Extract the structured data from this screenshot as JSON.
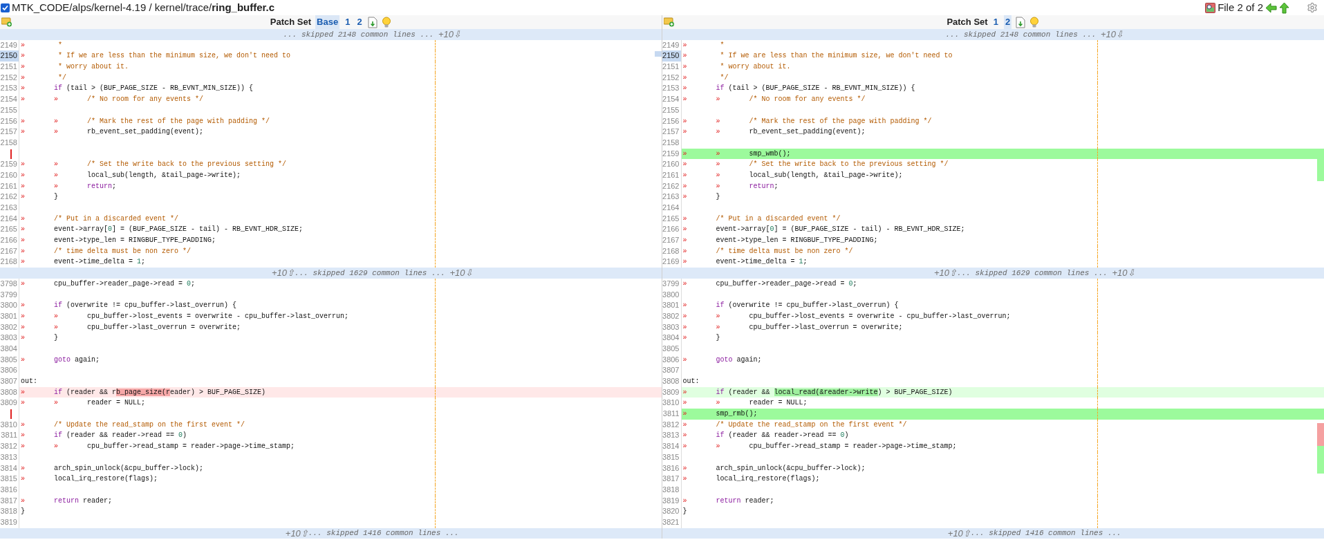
{
  "top_bar": {
    "reviewed": true,
    "path": "MTK_CODE/alps/kernel-4.19 / kernel/trace/",
    "file_name": "ring_buffer.c",
    "file_counter": "File 2 of 2"
  },
  "panes": [
    {
      "kind": "old",
      "patch_set": {
        "label": "Patch Set",
        "options": [
          {
            "label": "Base",
            "selected": true
          },
          {
            "label": "1",
            "selected": false
          },
          {
            "label": "2",
            "selected": false
          }
        ]
      },
      "sections": [
        {
          "kind": "skip",
          "text": "... skipped 2148 common lines ... ",
          "down": "+10⇩"
        },
        {
          "kind": "rows",
          "rows": [
            {
              "kind": "common",
              "number": "2149",
              "selected": false,
              "segments": [
                {
                  "kind": "tab",
                  "text": "»"
                },
                {
                  "kind": "comment",
                  "text": " *"
                }
              ]
            },
            {
              "kind": "common",
              "number": "2150",
              "selected": true,
              "segments": [
                {
                  "kind": "tab",
                  "text": "»"
                },
                {
                  "kind": "comment",
                  "text": " * If we are less than the minimum size, we don't need to"
                }
              ]
            },
            {
              "kind": "common",
              "number": "2151",
              "selected": false,
              "segments": [
                {
                  "kind": "tab",
                  "text": "»"
                },
                {
                  "kind": "comment",
                  "text": " * worry about it."
                }
              ]
            },
            {
              "kind": "common",
              "number": "2152",
              "selected": false,
              "segments": [
                {
                  "kind": "tab",
                  "text": "»"
                },
                {
                  "kind": "comment",
                  "text": " */"
                }
              ]
            },
            {
              "kind": "common",
              "number": "2153",
              "selected": false,
              "segments": [
                {
                  "kind": "tab",
                  "text": "»"
                },
                {
                  "kind": "keyword",
                  "text": "if"
                },
                {
                  "kind": "plain",
                  "text": " (tail > (BUF_PAGE_SIZE - RB_EVNT_MIN_SIZE)) {"
                }
              ]
            },
            {
              "kind": "common",
              "number": "2154",
              "selected": false,
              "segments": [
                {
                  "kind": "tab",
                  "text": "»"
                },
                {
                  "kind": "tab",
                  "text": "»"
                },
                {
                  "kind": "comment",
                  "text": "/* No room for any events */"
                }
              ]
            },
            {
              "kind": "common",
              "number": "2155",
              "selected": false
            },
            {
              "kind": "common",
              "number": "2156",
              "selected": false,
              "segments": [
                {
                  "kind": "tab",
                  "text": "»"
                },
                {
                  "kind": "tab",
                  "text": "»"
                },
                {
                  "kind": "comment",
                  "text": "/* Mark the rest of the page with padding */"
                }
              ]
            },
            {
              "kind": "common",
              "number": "2157",
              "selected": false,
              "segments": [
                {
                  "kind": "tab",
                  "text": "»"
                },
                {
                  "kind": "tab",
                  "text": "»"
                },
                {
                  "kind": "plain",
                  "text": "rb_event_set_padding(event);"
                }
              ]
            },
            {
              "kind": "common",
              "number": "2158",
              "selected": false
            },
            {
              "kind": "gap"
            },
            {
              "kind": "common",
              "number": "2159",
              "selected": false,
              "segments": [
                {
                  "kind": "tab",
                  "text": "»"
                },
                {
                  "kind": "tab",
                  "text": "»"
                },
                {
                  "kind": "comment",
                  "text": "/* Set the write back to the previous setting */"
                }
              ]
            },
            {
              "kind": "common",
              "number": "2160",
              "selected": false,
              "segments": [
                {
                  "kind": "tab",
                  "text": "»"
                },
                {
                  "kind": "tab",
                  "text": "»"
                },
                {
                  "kind": "plain",
                  "text": "local_sub(length, &tail_page->write);"
                }
              ]
            },
            {
              "kind": "common",
              "number": "2161",
              "selected": false,
              "segments": [
                {
                  "kind": "tab",
                  "text": "»"
                },
                {
                  "kind": "tab",
                  "text": "»"
                },
                {
                  "kind": "keyword",
                  "text": "return"
                },
                {
                  "kind": "plain",
                  "text": ";"
                }
              ]
            },
            {
              "kind": "common",
              "number": "2162",
              "selected": false,
              "segments": [
                {
                  "kind": "tab",
                  "text": "»"
                },
                {
                  "kind": "plain",
                  "text": "}"
                }
              ]
            },
            {
              "kind": "common",
              "number": "2163",
              "selected": false
            },
            {
              "kind": "common",
              "number": "2164",
              "selected": false,
              "segments": [
                {
                  "kind": "tab",
                  "text": "»"
                },
                {
                  "kind": "comment",
                  "text": "/* Put in a discarded event */"
                }
              ]
            },
            {
              "kind": "common",
              "number": "2165",
              "selected": false,
              "segments": [
                {
                  "kind": "tab",
                  "text": "»"
                },
                {
                  "kind": "plain",
                  "text": "event->array["
                },
                {
                  "kind": "number",
                  "text": "0"
                },
                {
                  "kind": "plain",
                  "text": "] = (BUF_PAGE_SIZE - tail) - RB_EVNT_HDR_SIZE;"
                }
              ]
            },
            {
              "kind": "common",
              "number": "2166",
              "selected": false,
              "segments": [
                {
                  "kind": "tab",
                  "text": "»"
                },
                {
                  "kind": "plain",
                  "text": "event->type_len = RINGBUF_TYPE_PADDING;"
                }
              ]
            },
            {
              "kind": "common",
              "number": "2167",
              "selected": false,
              "segments": [
                {
                  "kind": "tab",
                  "text": "»"
                },
                {
                  "kind": "comment",
                  "text": "/* time delta must be non zero */"
                }
              ]
            },
            {
              "kind": "common",
              "number": "2168",
              "selected": false,
              "segments": [
                {
                  "kind": "tab",
                  "text": "»"
                },
                {
                  "kind": "plain",
                  "text": "event->time_delta = "
                },
                {
                  "kind": "number",
                  "text": "1"
                },
                {
                  "kind": "plain",
                  "text": ";"
                }
              ]
            }
          ]
        },
        {
          "kind": "skip",
          "up": "+10⇧",
          "text": "... skipped 1629 common lines ... ",
          "down": "+10⇩"
        },
        {
          "kind": "rows",
          "rows": [
            {
              "kind": "common",
              "number": "3798",
              "selected": false,
              "segments": [
                {
                  "kind": "tab",
                  "text": "»"
                },
                {
                  "kind": "plain",
                  "text": "cpu_buffer->reader_page->read = "
                },
                {
                  "kind": "number",
                  "text": "0"
                },
                {
                  "kind": "plain",
                  "text": ";"
                }
              ]
            },
            {
              "kind": "common",
              "number": "3799",
              "selected": false
            },
            {
              "kind": "common",
              "number": "3800",
              "selected": false,
              "segments": [
                {
                  "kind": "tab",
                  "text": "»"
                },
                {
                  "kind": "keyword",
                  "text": "if"
                },
                {
                  "kind": "plain",
                  "text": " (overwrite != cpu_buffer->last_overrun) {"
                }
              ]
            },
            {
              "kind": "common",
              "number": "3801",
              "selected": false,
              "segments": [
                {
                  "kind": "tab",
                  "text": "»"
                },
                {
                  "kind": "tab",
                  "text": "»"
                },
                {
                  "kind": "plain",
                  "text": "cpu_buffer->lost_events = overwrite - cpu_buffer->last_overrun;"
                }
              ]
            },
            {
              "kind": "common",
              "number": "3802",
              "selected": false,
              "segments": [
                {
                  "kind": "tab",
                  "text": "»"
                },
                {
                  "kind": "tab",
                  "text": "»"
                },
                {
                  "kind": "plain",
                  "text": "cpu_buffer->last_overrun = overwrite;"
                }
              ]
            },
            {
              "kind": "common",
              "number": "3803",
              "selected": false,
              "segments": [
                {
                  "kind": "tab",
                  "text": "»"
                },
                {
                  "kind": "plain",
                  "text": "}"
                }
              ]
            },
            {
              "kind": "common",
              "number": "3804",
              "selected": false
            },
            {
              "kind": "common",
              "number": "3805",
              "selected": false,
              "segments": [
                {
                  "kind": "tab",
                  "text": "»"
                },
                {
                  "kind": "keyword",
                  "text": "goto"
                },
                {
                  "kind": "plain",
                  "text": " again;"
                }
              ]
            },
            {
              "kind": "common",
              "number": "3806",
              "selected": false
            },
            {
              "kind": "common",
              "number": "3807",
              "selected": false,
              "segments": [
                {
                  "kind": "plain",
                  "text": "out:"
                }
              ]
            },
            {
              "kind": "edited",
              "number": "3808",
              "selected": false,
              "segments": [
                {
                  "kind": "tab",
                  "text": "»"
                },
                {
                  "kind": "keyword",
                  "text": "if"
                },
                {
                  "kind": "plain",
                  "text": " (reader && r"
                },
                {
                  "kind": "changed",
                  "text": "b_page_size(r"
                },
                {
                  "kind": "plain",
                  "text": "eader) > BUF_PAGE_SIZE)"
                }
              ]
            },
            {
              "kind": "common",
              "number": "3809",
              "selected": false,
              "segments": [
                {
                  "kind": "tab",
                  "text": "»"
                },
                {
                  "kind": "tab",
                  "text": "»"
                },
                {
                  "kind": "plain",
                  "text": "reader = NULL;"
                }
              ]
            },
            {
              "kind": "gap"
            },
            {
              "kind": "common",
              "number": "3810",
              "selected": false,
              "segments": [
                {
                  "kind": "tab",
                  "text": "»"
                },
                {
                  "kind": "comment",
                  "text": "/* Update the read_stamp on the first event */"
                }
              ]
            },
            {
              "kind": "common",
              "number": "3811",
              "selected": false,
              "segments": [
                {
                  "kind": "tab",
                  "text": "»"
                },
                {
                  "kind": "keyword",
                  "text": "if"
                },
                {
                  "kind": "plain",
                  "text": " (reader && reader->read == "
                },
                {
                  "kind": "number",
                  "text": "0"
                },
                {
                  "kind": "plain",
                  "text": ")"
                }
              ]
            },
            {
              "kind": "common",
              "number": "3812",
              "selected": false,
              "segments": [
                {
                  "kind": "tab",
                  "text": "»"
                },
                {
                  "kind": "tab",
                  "text": "»"
                },
                {
                  "kind": "plain",
                  "text": "cpu_buffer->read_stamp = reader->page->time_stamp;"
                }
              ]
            },
            {
              "kind": "common",
              "number": "3813",
              "selected": false
            },
            {
              "kind": "common",
              "number": "3814",
              "selected": false,
              "segments": [
                {
                  "kind": "tab",
                  "text": "»"
                },
                {
                  "kind": "plain",
                  "text": "arch_spin_unlock(&cpu_buffer->lock);"
                }
              ]
            },
            {
              "kind": "common",
              "number": "3815",
              "selected": false,
              "segments": [
                {
                  "kind": "tab",
                  "text": "»"
                },
                {
                  "kind": "plain",
                  "text": "local_irq_restore(flags);"
                }
              ]
            },
            {
              "kind": "common",
              "number": "3816",
              "selected": false
            },
            {
              "kind": "common",
              "number": "3817",
              "selected": false,
              "segments": [
                {
                  "kind": "tab",
                  "text": "»"
                },
                {
                  "kind": "keyword",
                  "text": "return"
                },
                {
                  "kind": "plain",
                  "text": " reader;"
                }
              ]
            },
            {
              "kind": "common",
              "number": "3818",
              "selected": false,
              "segments": [
                {
                  "kind": "plain",
                  "text": "}"
                }
              ]
            },
            {
              "kind": "common",
              "number": "3819",
              "selected": false
            }
          ]
        },
        {
          "kind": "skip",
          "up": "+10⇧",
          "text": "... skipped 1416 common lines ..."
        }
      ]
    },
    {
      "kind": "new",
      "patch_set": {
        "label": "Patch Set",
        "options": [
          {
            "label": "1",
            "selected": false
          },
          {
            "label": "2",
            "selected": true
          }
        ]
      },
      "sections": [
        {
          "kind": "skip",
          "text": "... skipped 2148 common lines ... ",
          "down": "+10⇩"
        },
        {
          "kind": "rows",
          "rows": [
            {
              "kind": "common",
              "number": "2149",
              "selected": false,
              "segments": [
                {
                  "kind": "tab",
                  "text": "»"
                },
                {
                  "kind": "comment",
                  "text": " *"
                }
              ]
            },
            {
              "kind": "common",
              "number": "2150",
              "selected": true,
              "segments": [
                {
                  "kind": "tab",
                  "text": "»"
                },
                {
                  "kind": "comment",
                  "text": " * If we are less than the minimum size, we don't need to"
                }
              ]
            },
            {
              "kind": "common",
              "number": "2151",
              "selected": false,
              "segments": [
                {
                  "kind": "tab",
                  "text": "»"
                },
                {
                  "kind": "comment",
                  "text": " * worry about it."
                }
              ]
            },
            {
              "kind": "common",
              "number": "2152",
              "selected": false,
              "segments": [
                {
                  "kind": "tab",
                  "text": "»"
                },
                {
                  "kind": "comment",
                  "text": " */"
                }
              ]
            },
            {
              "kind": "common",
              "number": "2153",
              "selected": false,
              "segments": [
                {
                  "kind": "tab",
                  "text": "»"
                },
                {
                  "kind": "keyword",
                  "text": "if"
                },
                {
                  "kind": "plain",
                  "text": " (tail > (BUF_PAGE_SIZE - RB_EVNT_MIN_SIZE)) {"
                }
              ]
            },
            {
              "kind": "common",
              "number": "2154",
              "selected": false,
              "segments": [
                {
                  "kind": "tab",
                  "text": "»"
                },
                {
                  "kind": "tab",
                  "text": "»"
                },
                {
                  "kind": "comment",
                  "text": "/* No room for any events */"
                }
              ]
            },
            {
              "kind": "common",
              "number": "2155",
              "selected": false
            },
            {
              "kind": "common",
              "number": "2156",
              "selected": false,
              "segments": [
                {
                  "kind": "tab",
                  "text": "»"
                },
                {
                  "kind": "tab",
                  "text": "»"
                },
                {
                  "kind": "comment",
                  "text": "/* Mark the rest of the page with padding */"
                }
              ]
            },
            {
              "kind": "common",
              "number": "2157",
              "selected": false,
              "segments": [
                {
                  "kind": "tab",
                  "text": "»"
                },
                {
                  "kind": "tab",
                  "text": "»"
                },
                {
                  "kind": "plain",
                  "text": "rb_event_set_padding(event);"
                }
              ]
            },
            {
              "kind": "common",
              "number": "2158",
              "selected": false
            },
            {
              "kind": "inserted",
              "number": "2159",
              "selected": false,
              "segments": [
                {
                  "kind": "tab",
                  "text": "»"
                },
                {
                  "kind": "tab",
                  "text": "»"
                },
                {
                  "kind": "plain",
                  "text": "smp_wmb();"
                }
              ]
            },
            {
              "kind": "common",
              "number": "2160",
              "selected": false,
              "segments": [
                {
                  "kind": "tab",
                  "text": "»"
                },
                {
                  "kind": "tab",
                  "text": "»"
                },
                {
                  "kind": "comment",
                  "text": "/* Set the write back to the previous setting */"
                }
              ]
            },
            {
              "kind": "common",
              "number": "2161",
              "selected": false,
              "segments": [
                {
                  "kind": "tab",
                  "text": "»"
                },
                {
                  "kind": "tab",
                  "text": "»"
                },
                {
                  "kind": "plain",
                  "text": "local_sub(length, &tail_page->write);"
                }
              ]
            },
            {
              "kind": "common",
              "number": "2162",
              "selected": false,
              "segments": [
                {
                  "kind": "tab",
                  "text": "»"
                },
                {
                  "kind": "tab",
                  "text": "»"
                },
                {
                  "kind": "keyword",
                  "text": "return"
                },
                {
                  "kind": "plain",
                  "text": ";"
                }
              ]
            },
            {
              "kind": "common",
              "number": "2163",
              "selected": false,
              "segments": [
                {
                  "kind": "tab",
                  "text": "»"
                },
                {
                  "kind": "plain",
                  "text": "}"
                }
              ]
            },
            {
              "kind": "common",
              "number": "2164",
              "selected": false
            },
            {
              "kind": "common",
              "number": "2165",
              "selected": false,
              "segments": [
                {
                  "kind": "tab",
                  "text": "»"
                },
                {
                  "kind": "comment",
                  "text": "/* Put in a discarded event */"
                }
              ]
            },
            {
              "kind": "common",
              "number": "2166",
              "selected": false,
              "segments": [
                {
                  "kind": "tab",
                  "text": "»"
                },
                {
                  "kind": "plain",
                  "text": "event->array["
                },
                {
                  "kind": "number",
                  "text": "0"
                },
                {
                  "kind": "plain",
                  "text": "] = (BUF_PAGE_SIZE - tail) - RB_EVNT_HDR_SIZE;"
                }
              ]
            },
            {
              "kind": "common",
              "number": "2167",
              "selected": false,
              "segments": [
                {
                  "kind": "tab",
                  "text": "»"
                },
                {
                  "kind": "plain",
                  "text": "event->type_len = RINGBUF_TYPE_PADDING;"
                }
              ]
            },
            {
              "kind": "common",
              "number": "2168",
              "selected": false,
              "segments": [
                {
                  "kind": "tab",
                  "text": "»"
                },
                {
                  "kind": "comment",
                  "text": "/* time delta must be non zero */"
                }
              ]
            },
            {
              "kind": "common",
              "number": "2169",
              "selected": false,
              "segments": [
                {
                  "kind": "tab",
                  "text": "»"
                },
                {
                  "kind": "plain",
                  "text": "event->time_delta = "
                },
                {
                  "kind": "number",
                  "text": "1"
                },
                {
                  "kind": "plain",
                  "text": ";"
                }
              ]
            }
          ]
        },
        {
          "kind": "skip",
          "up": "+10⇧",
          "text": "... skipped 1629 common lines ... ",
          "down": "+10⇩"
        },
        {
          "kind": "rows",
          "rows": [
            {
              "kind": "common",
              "number": "3799",
              "selected": false,
              "segments": [
                {
                  "kind": "tab",
                  "text": "»"
                },
                {
                  "kind": "plain",
                  "text": "cpu_buffer->reader_page->read = "
                },
                {
                  "kind": "number",
                  "text": "0"
                },
                {
                  "kind": "plain",
                  "text": ";"
                }
              ]
            },
            {
              "kind": "common",
              "number": "3800",
              "selected": false
            },
            {
              "kind": "common",
              "number": "3801",
              "selected": false,
              "segments": [
                {
                  "kind": "tab",
                  "text": "»"
                },
                {
                  "kind": "keyword",
                  "text": "if"
                },
                {
                  "kind": "plain",
                  "text": " (overwrite != cpu_buffer->last_overrun) {"
                }
              ]
            },
            {
              "kind": "common",
              "number": "3802",
              "selected": false,
              "segments": [
                {
                  "kind": "tab",
                  "text": "»"
                },
                {
                  "kind": "tab",
                  "text": "»"
                },
                {
                  "kind": "plain",
                  "text": "cpu_buffer->lost_events = overwrite - cpu_buffer->last_overrun;"
                }
              ]
            },
            {
              "kind": "common",
              "number": "3803",
              "selected": false,
              "segments": [
                {
                  "kind": "tab",
                  "text": "»"
                },
                {
                  "kind": "tab",
                  "text": "»"
                },
                {
                  "kind": "plain",
                  "text": "cpu_buffer->last_overrun = overwrite;"
                }
              ]
            },
            {
              "kind": "common",
              "number": "3804",
              "selected": false,
              "segments": [
                {
                  "kind": "tab",
                  "text": "»"
                },
                {
                  "kind": "plain",
                  "text": "}"
                }
              ]
            },
            {
              "kind": "common",
              "number": "3805",
              "selected": false
            },
            {
              "kind": "common",
              "number": "3806",
              "selected": false,
              "segments": [
                {
                  "kind": "tab",
                  "text": "»"
                },
                {
                  "kind": "keyword",
                  "text": "goto"
                },
                {
                  "kind": "plain",
                  "text": " again;"
                }
              ]
            },
            {
              "kind": "common",
              "number": "3807",
              "selected": false
            },
            {
              "kind": "common",
              "number": "3808",
              "selected": false,
              "segments": [
                {
                  "kind": "plain",
                  "text": "out:"
                }
              ]
            },
            {
              "kind": "edited",
              "number": "3809",
              "selected": false,
              "segments": [
                {
                  "kind": "tab",
                  "text": "»"
                },
                {
                  "kind": "keyword",
                  "text": "if"
                },
                {
                  "kind": "plain",
                  "text": " (reader && "
                },
                {
                  "kind": "changed",
                  "text": "local_read(&reader->write"
                },
                {
                  "kind": "plain",
                  "text": ") > BUF_PAGE_SIZE)"
                }
              ]
            },
            {
              "kind": "common",
              "number": "3810",
              "selected": false,
              "segments": [
                {
                  "kind": "tab",
                  "text": "»"
                },
                {
                  "kind": "tab",
                  "text": "»"
                },
                {
                  "kind": "plain",
                  "text": "reader = NULL;"
                }
              ]
            },
            {
              "kind": "inserted",
              "number": "3811",
              "selected": false,
              "segments": [
                {
                  "kind": "tab",
                  "text": "»"
                },
                {
                  "kind": "plain",
                  "text": "smp_rmb();"
                }
              ]
            },
            {
              "kind": "common",
              "number": "3812",
              "selected": false,
              "segments": [
                {
                  "kind": "tab",
                  "text": "»"
                },
                {
                  "kind": "comment",
                  "text": "/* Update the read_stamp on the first event */"
                }
              ]
            },
            {
              "kind": "common",
              "number": "3813",
              "selected": false,
              "segments": [
                {
                  "kind": "tab",
                  "text": "»"
                },
                {
                  "kind": "keyword",
                  "text": "if"
                },
                {
                  "kind": "plain",
                  "text": " (reader && reader->read == "
                },
                {
                  "kind": "number",
                  "text": "0"
                },
                {
                  "kind": "plain",
                  "text": ")"
                }
              ]
            },
            {
              "kind": "common",
              "number": "3814",
              "selected": false,
              "segments": [
                {
                  "kind": "tab",
                  "text": "»"
                },
                {
                  "kind": "tab",
                  "text": "»"
                },
                {
                  "kind": "plain",
                  "text": "cpu_buffer->read_stamp = reader->page->time_stamp;"
                }
              ]
            },
            {
              "kind": "common",
              "number": "3815",
              "selected": false
            },
            {
              "kind": "common",
              "number": "3816",
              "selected": false,
              "segments": [
                {
                  "kind": "tab",
                  "text": "»"
                },
                {
                  "kind": "plain",
                  "text": "arch_spin_unlock(&cpu_buffer->lock);"
                }
              ]
            },
            {
              "kind": "common",
              "number": "3817",
              "selected": false,
              "segments": [
                {
                  "kind": "tab",
                  "text": "»"
                },
                {
                  "kind": "plain",
                  "text": "local_irq_restore(flags);"
                }
              ]
            },
            {
              "kind": "common",
              "number": "3818",
              "selected": false
            },
            {
              "kind": "common",
              "number": "3819",
              "selected": false,
              "segments": [
                {
                  "kind": "tab",
                  "text": "»"
                },
                {
                  "kind": "keyword",
                  "text": "return"
                },
                {
                  "kind": "plain",
                  "text": " reader;"
                }
              ]
            },
            {
              "kind": "common",
              "number": "3820",
              "selected": false,
              "segments": [
                {
                  "kind": "plain",
                  "text": "}"
                }
              ]
            },
            {
              "kind": "common",
              "number": "3821",
              "selected": false
            }
          ]
        },
        {
          "kind": "skip",
          "up": "+10⇧",
          "text": "... skipped 1416 common lines ..."
        }
      ]
    }
  ]
}
